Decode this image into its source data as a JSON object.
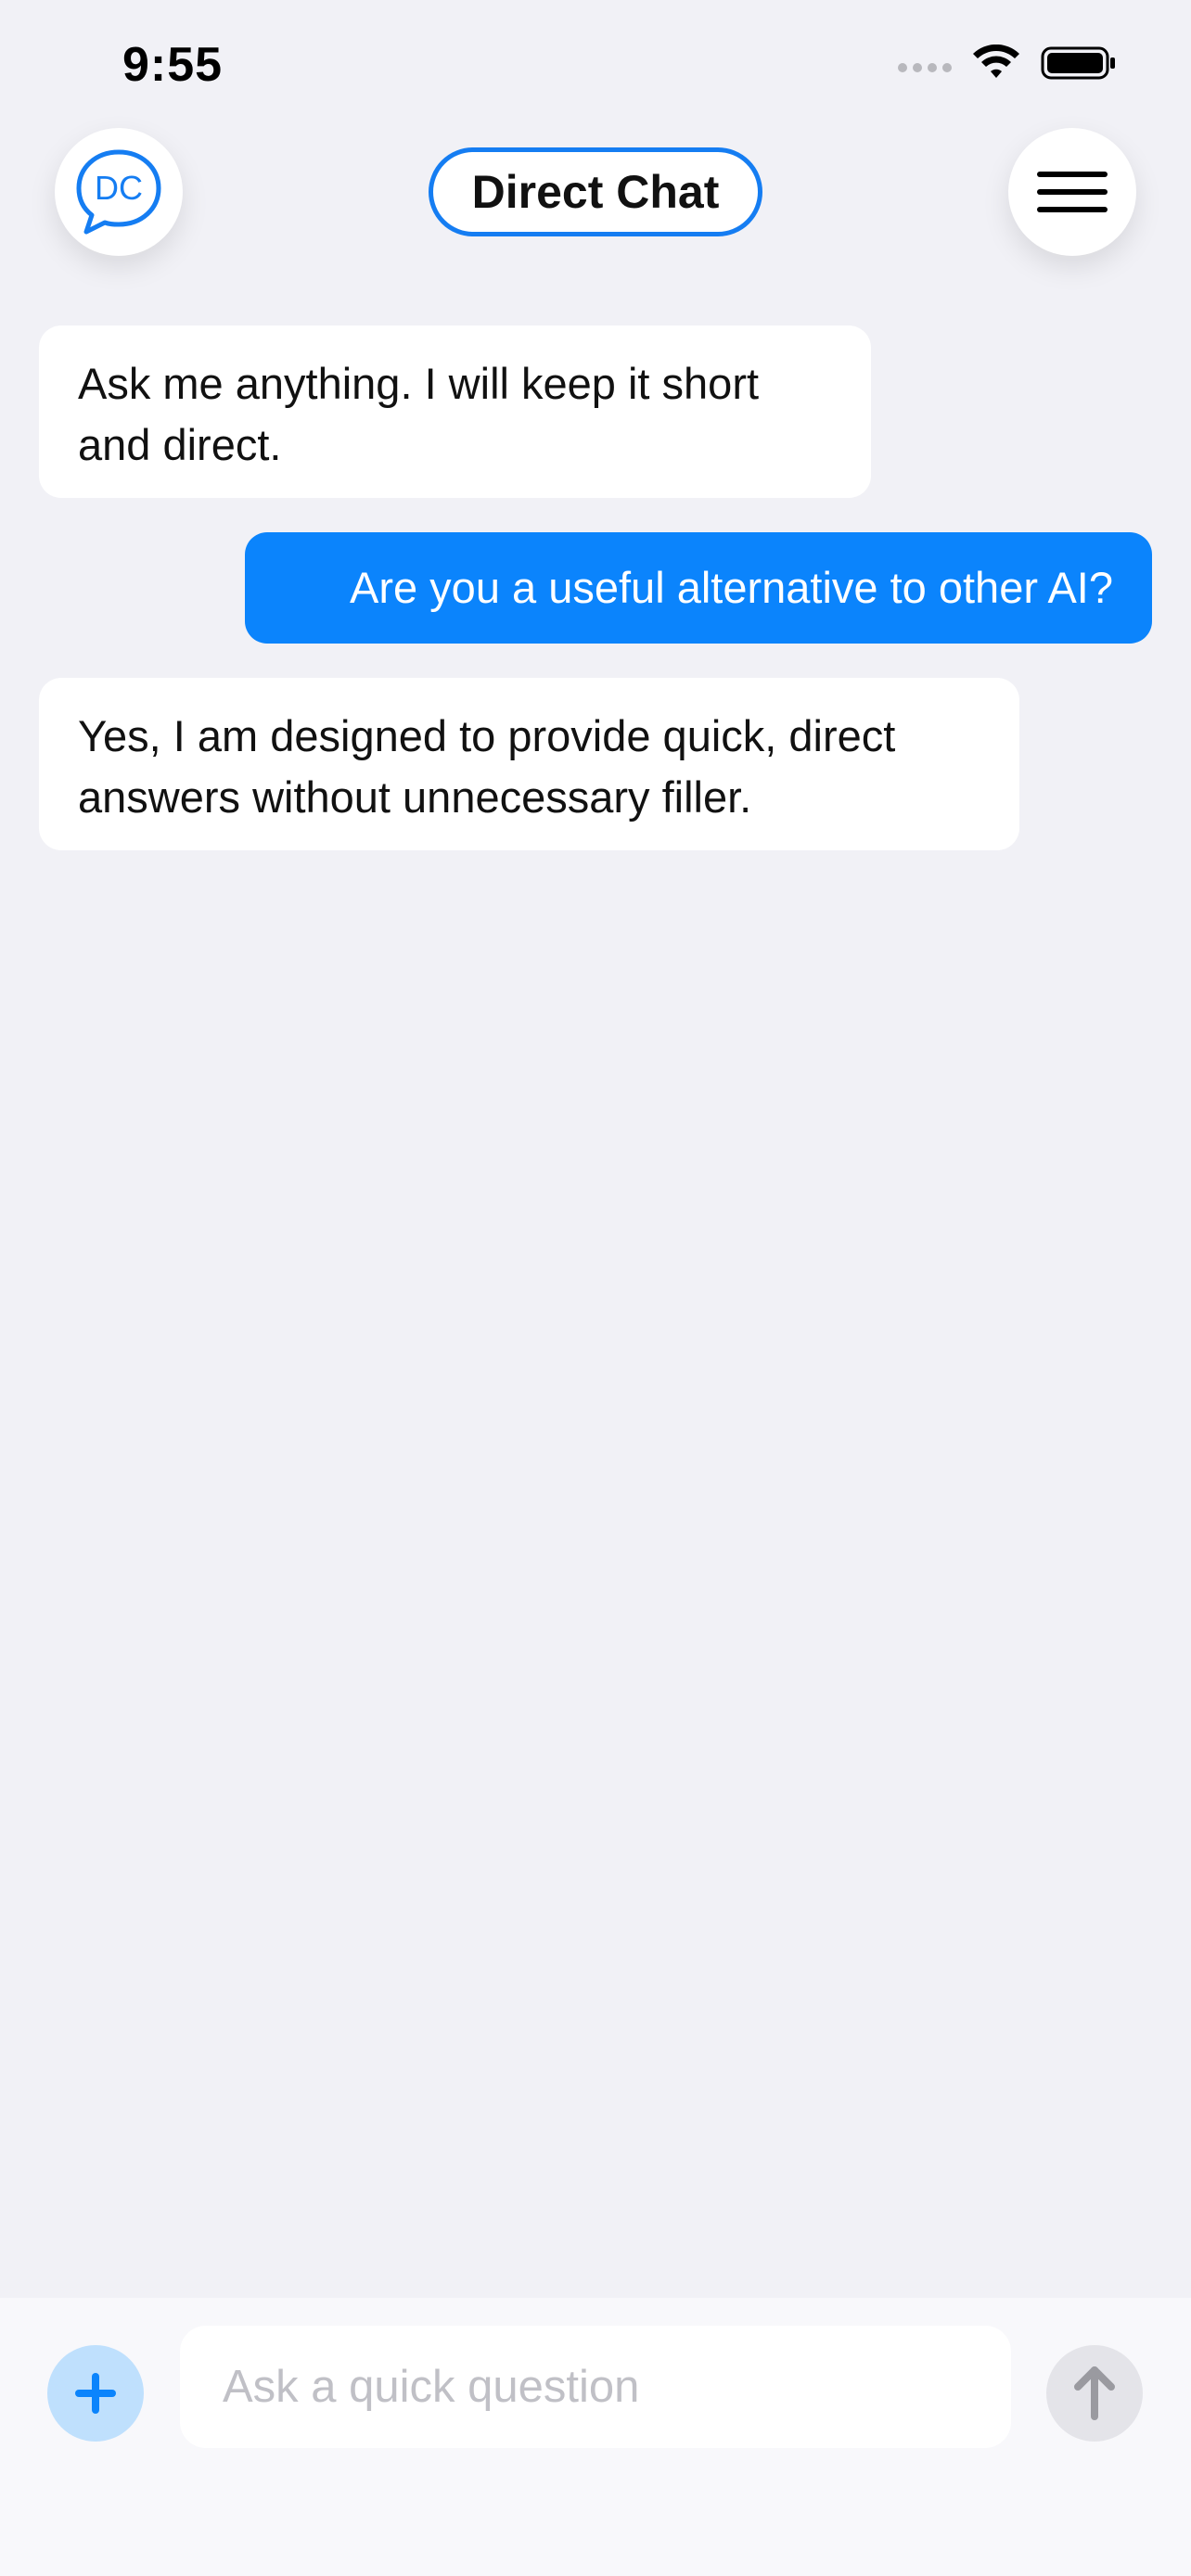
{
  "status_bar": {
    "time": "9:55",
    "icons": [
      "cellular-dots-icon",
      "wifi-icon",
      "battery-icon"
    ]
  },
  "header": {
    "logo_text": "DC",
    "title": "Direct Chat",
    "menu_icon": "hamburger-menu-icon"
  },
  "messages": [
    {
      "role": "assistant",
      "text": "Ask me anything. I will keep it short and direct."
    },
    {
      "role": "user",
      "text": "Are you a useful alternative to other AI?"
    },
    {
      "role": "assistant",
      "text": "Yes, I am designed to provide quick, direct answers without unnecessary filler."
    }
  ],
  "composer": {
    "placeholder": "Ask a quick question",
    "value": "",
    "add_icon": "plus-icon",
    "send_icon": "arrow-up-icon"
  },
  "colors": {
    "accent": "#0b84fc",
    "background": "#f1f1f6",
    "bubble_bot": "#ffffff",
    "bubble_user": "#0b84fc",
    "send_disabled": "#e4e4e9"
  }
}
